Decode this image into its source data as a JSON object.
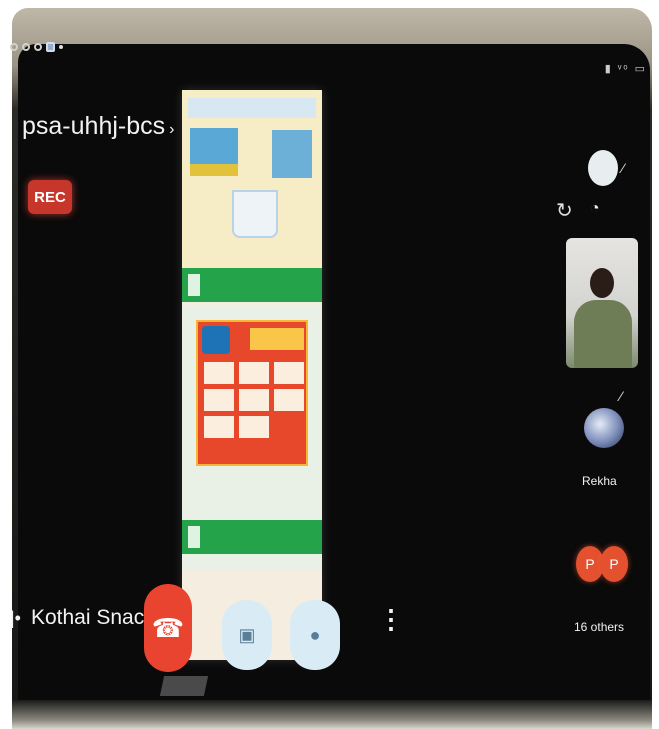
{
  "meeting": {
    "code": "psa-uhhj-bcs",
    "code_caret": "›",
    "recording_badge": "REC"
  },
  "status_bar": {
    "right_indicators": "▮ ᵛᵒ ▭"
  },
  "participants": {
    "named": [
      {
        "name": "Rekha"
      }
    ],
    "avatars": [
      "P",
      "P"
    ],
    "others_label": "16 others"
  },
  "presenter": {
    "bullet": "|•",
    "name": "Kothai Snac"
  },
  "controls": {
    "end_call_icon": "hang-up-icon",
    "camera_icon": "camera-off-icon",
    "mic_icon": "microphone-icon",
    "more_glyph": "⋮"
  },
  "colors": {
    "rec_red": "#c6362b",
    "end_call_red": "#e8442f",
    "control_light_blue": "#d9ecf6",
    "avatar_orange": "#e4512e",
    "slide_green": "#24a34a"
  }
}
